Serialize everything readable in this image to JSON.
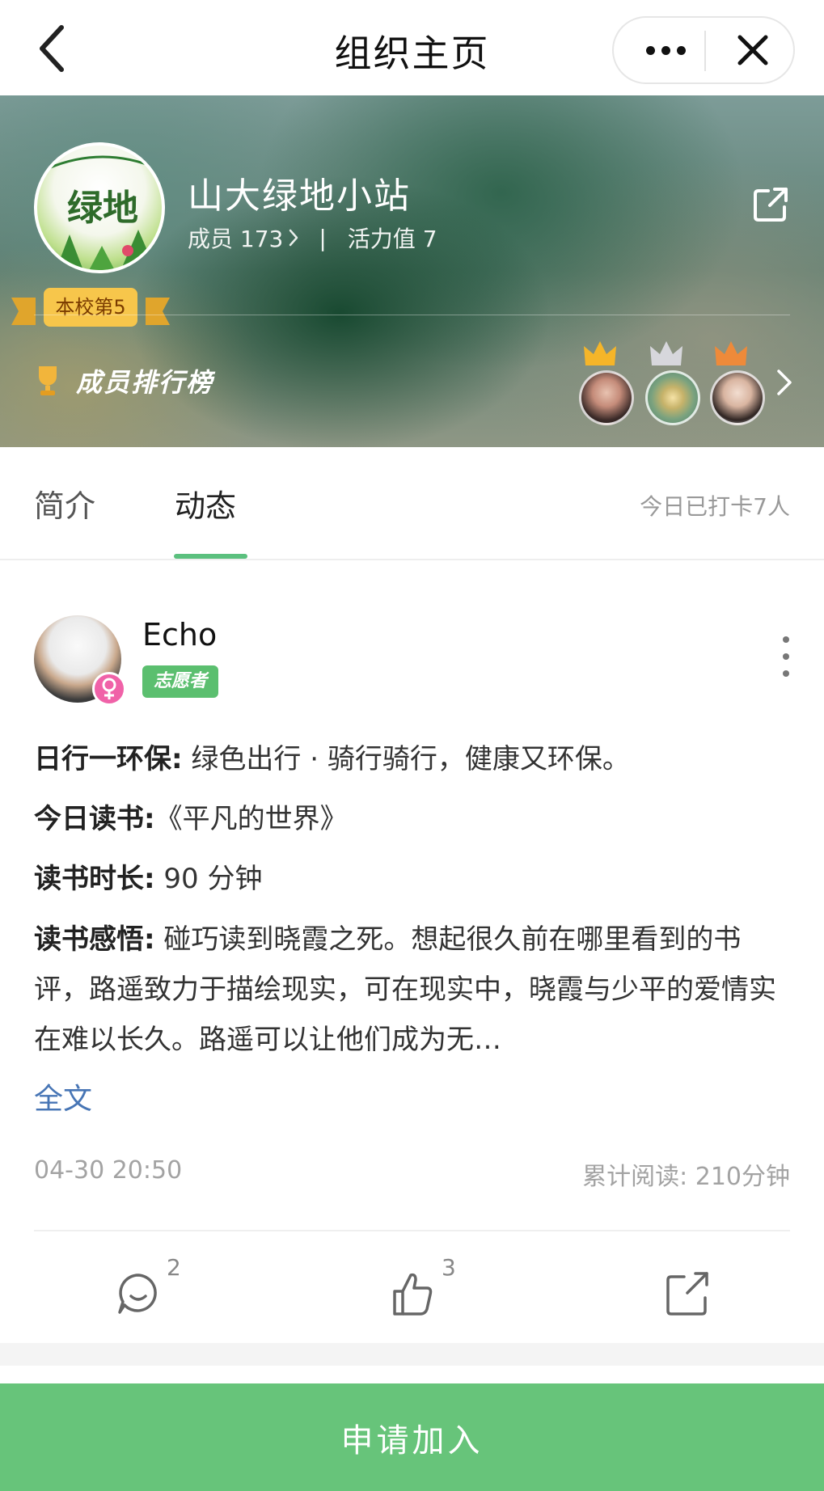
{
  "navbar": {
    "title": "组织主页",
    "back_icon": "chevron-left-icon",
    "more_icon": "more-dots-icon",
    "close_icon": "close-icon"
  },
  "group": {
    "name": "山大绿地小站",
    "members_label": "成员 173",
    "divider": "|",
    "vitality_label": "活力值 7",
    "school_rank_badge": "本校第5",
    "logo_lettering": "绿地小站",
    "leaderboard_label": "成员排行榜",
    "leaderboard_avatar_count": 3
  },
  "tabs": {
    "items": [
      {
        "label": "简介",
        "active": false
      },
      {
        "label": "动态",
        "active": true
      }
    ],
    "checkin_summary": "今日已打卡7人"
  },
  "post": {
    "user_name": "Echo",
    "user_tag": "志愿者",
    "gender": "female",
    "line1_label": "日行一环保:",
    "line1_value": " 绿色出行 · 骑行骑行，健康又环保。",
    "line2_label": "今日读书:",
    "line2_value": "《平凡的世界》",
    "line3_label": "读书时长:",
    "line3_value": " 90 分钟",
    "line4_label": "读书感悟:",
    "line4_value": " 碰巧读到晓霞之死。想起很久前在哪里看到的书评，路遥致力于描绘现实，可在现实中，晓霞与少平的爱情实在难以长久。路遥可以让他们成为无…",
    "fulltext_link": "全文",
    "timestamp": "04-30 20:50",
    "total_reading": "累计阅读: 210分钟",
    "comment_count": "2",
    "like_count": "3"
  },
  "join_button": {
    "label": "申请加入"
  },
  "colors": {
    "accent_green": "#67c47a",
    "tab_underline": "#5bc07e",
    "link_blue": "#4775b5",
    "volunteer_tag": "#5bbf6f",
    "rank_badge": "#f7c64b"
  }
}
